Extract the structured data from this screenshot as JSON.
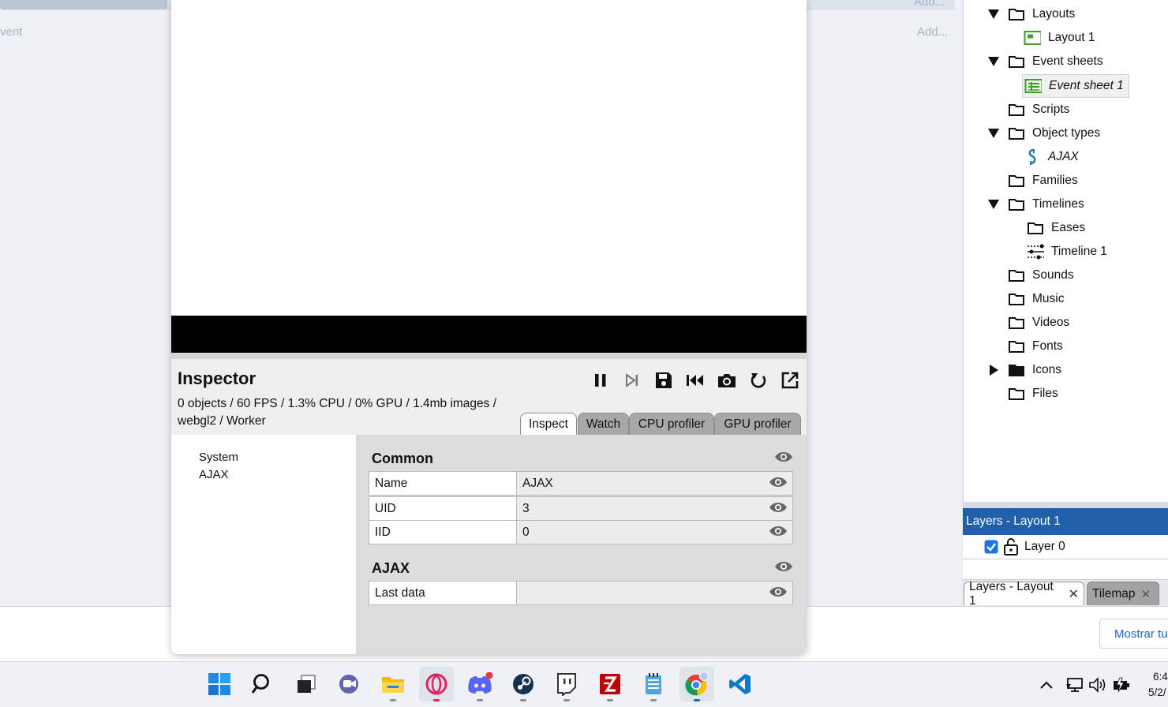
{
  "background": {
    "left_ghost": "vent",
    "add_top": "Add...",
    "add_second": "Add..."
  },
  "project_tree": {
    "items": [
      {
        "label": "Layouts",
        "icon": "folder-icon",
        "expanded": true
      },
      {
        "label": "Layout 1",
        "icon": "layout-icon"
      },
      {
        "label": "Event sheets",
        "icon": "folder-icon",
        "expanded": true
      },
      {
        "label": "Event sheet 1",
        "icon": "event-sheet-icon"
      },
      {
        "label": "Scripts",
        "icon": "folder-icon"
      },
      {
        "label": "Object types",
        "icon": "folder-icon",
        "expanded": true
      },
      {
        "label": "AJAX",
        "icon": "ajax-icon"
      },
      {
        "label": "Families",
        "icon": "folder-icon"
      },
      {
        "label": "Timelines",
        "icon": "folder-icon",
        "expanded": true
      },
      {
        "label": "Eases",
        "icon": "folder-icon"
      },
      {
        "label": "Timeline 1",
        "icon": "timeline-icon"
      },
      {
        "label": "Sounds",
        "icon": "folder-icon"
      },
      {
        "label": "Music",
        "icon": "folder-icon"
      },
      {
        "label": "Videos",
        "icon": "folder-icon"
      },
      {
        "label": "Fonts",
        "icon": "folder-icon"
      },
      {
        "label": "Icons",
        "icon": "folder-filled-icon",
        "expanded": false
      },
      {
        "label": "Files",
        "icon": "folder-icon"
      }
    ]
  },
  "layers": {
    "header": "Layers - Layout 1",
    "layer_name": "Layer 0",
    "layer_checked": true
  },
  "panel_tabs": {
    "layers": "Layers - Layout 1",
    "tilemap": "Tilemap"
  },
  "footer": {
    "show_button": "Mostrar tu"
  },
  "inspector": {
    "title": "Inspector",
    "stats": "0 objects / 60 FPS / 1.3% CPU / 0% GPU / 1.4mb images / webgl2 / Worker",
    "tabs": [
      "Inspect",
      "Watch",
      "CPU profiler",
      "GPU profiler"
    ],
    "active_tab": "Inspect",
    "objects": [
      "System",
      "AJAX"
    ],
    "sections": {
      "common": {
        "title": "Common",
        "rows": [
          {
            "name": "Name",
            "value": "AJAX"
          },
          {
            "name": "UID",
            "value": "3"
          },
          {
            "name": "IID",
            "value": "0"
          }
        ]
      },
      "ajax": {
        "title": "AJAX",
        "rows": [
          {
            "name": "Last data",
            "value": ""
          }
        ]
      }
    }
  },
  "taskbar": {
    "apps": [
      "windows-start-icon",
      "search-icon",
      "task-view-icon",
      "chat-icon",
      "file-explorer-icon",
      "opera-gx-icon",
      "discord-icon",
      "steam-icon",
      "twitch-icon",
      "filezilla-icon",
      "notepad-icon",
      "chrome-icon",
      "vscode-icon"
    ],
    "clock_time": "6:4",
    "clock_date": "5/2/"
  },
  "colors": {
    "layers_header": "#2160a8",
    "green_icon": "#3e9e27",
    "accent_blue": "#1e63c4"
  }
}
